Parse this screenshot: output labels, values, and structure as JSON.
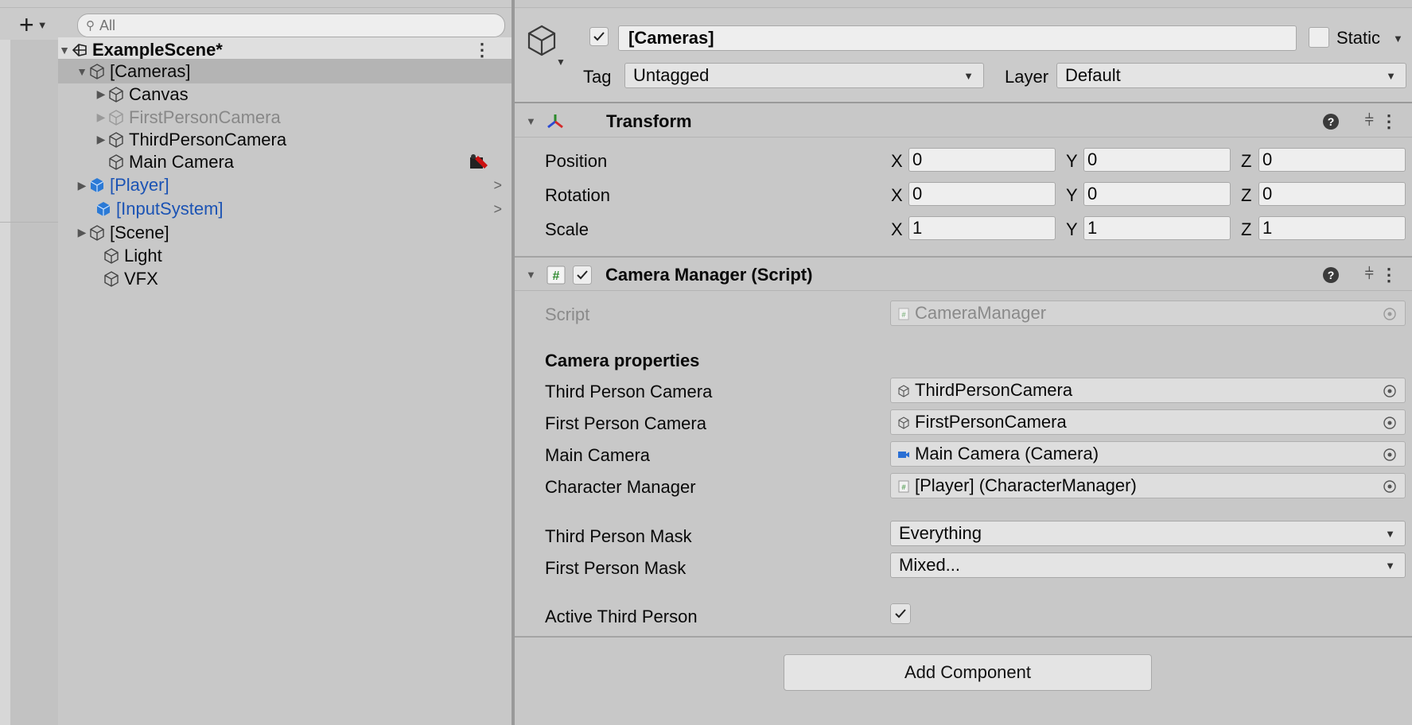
{
  "hierarchy": {
    "search_placeholder": "All",
    "scene": {
      "name": "ExampleScene*"
    },
    "items": [
      {
        "label": "[Cameras]"
      },
      {
        "label": "Canvas"
      },
      {
        "label": "FirstPersonCamera"
      },
      {
        "label": "ThirdPersonCamera"
      },
      {
        "label": "Main Camera"
      },
      {
        "label": "[Player]"
      },
      {
        "label": "[InputSystem]"
      },
      {
        "label": "[Scene]"
      },
      {
        "label": "Light"
      },
      {
        "label": "VFX"
      }
    ]
  },
  "inspector": {
    "gameobject": {
      "name": "[Cameras]",
      "active": true,
      "static_label": "Static",
      "tag_label": "Tag",
      "tag_value": "Untagged",
      "layer_label": "Layer",
      "layer_value": "Default"
    },
    "transform": {
      "title": "Transform",
      "position_label": "Position",
      "rotation_label": "Rotation",
      "scale_label": "Scale",
      "axis": {
        "x": "X",
        "y": "Y",
        "z": "Z"
      },
      "position": {
        "x": "0",
        "y": "0",
        "z": "0"
      },
      "rotation": {
        "x": "0",
        "y": "0",
        "z": "0"
      },
      "scale": {
        "x": "1",
        "y": "1",
        "z": "1"
      }
    },
    "camera_manager": {
      "title": "Camera Manager (Script)",
      "enabled": true,
      "script_label": "Script",
      "script_value": "CameraManager",
      "section_header": "Camera properties",
      "third_person_camera_label": "Third Person Camera",
      "third_person_camera_value": "ThirdPersonCamera",
      "first_person_camera_label": "First Person Camera",
      "first_person_camera_value": "FirstPersonCamera",
      "main_camera_label": "Main Camera",
      "main_camera_value": "Main Camera (Camera)",
      "character_manager_label": "Character Manager",
      "character_manager_value": "[Player] (CharacterManager)",
      "third_person_mask_label": "Third Person Mask",
      "third_person_mask_value": "Everything",
      "first_person_mask_label": "First Person Mask",
      "first_person_mask_value": "Mixed...",
      "active_third_person_label": "Active Third Person",
      "active_third_person": true
    },
    "add_component_label": "Add Component"
  },
  "colors": {
    "prefab_blue": "#1b53b4",
    "dim_text": "#888888",
    "panel_bg": "#c8c8c8"
  }
}
